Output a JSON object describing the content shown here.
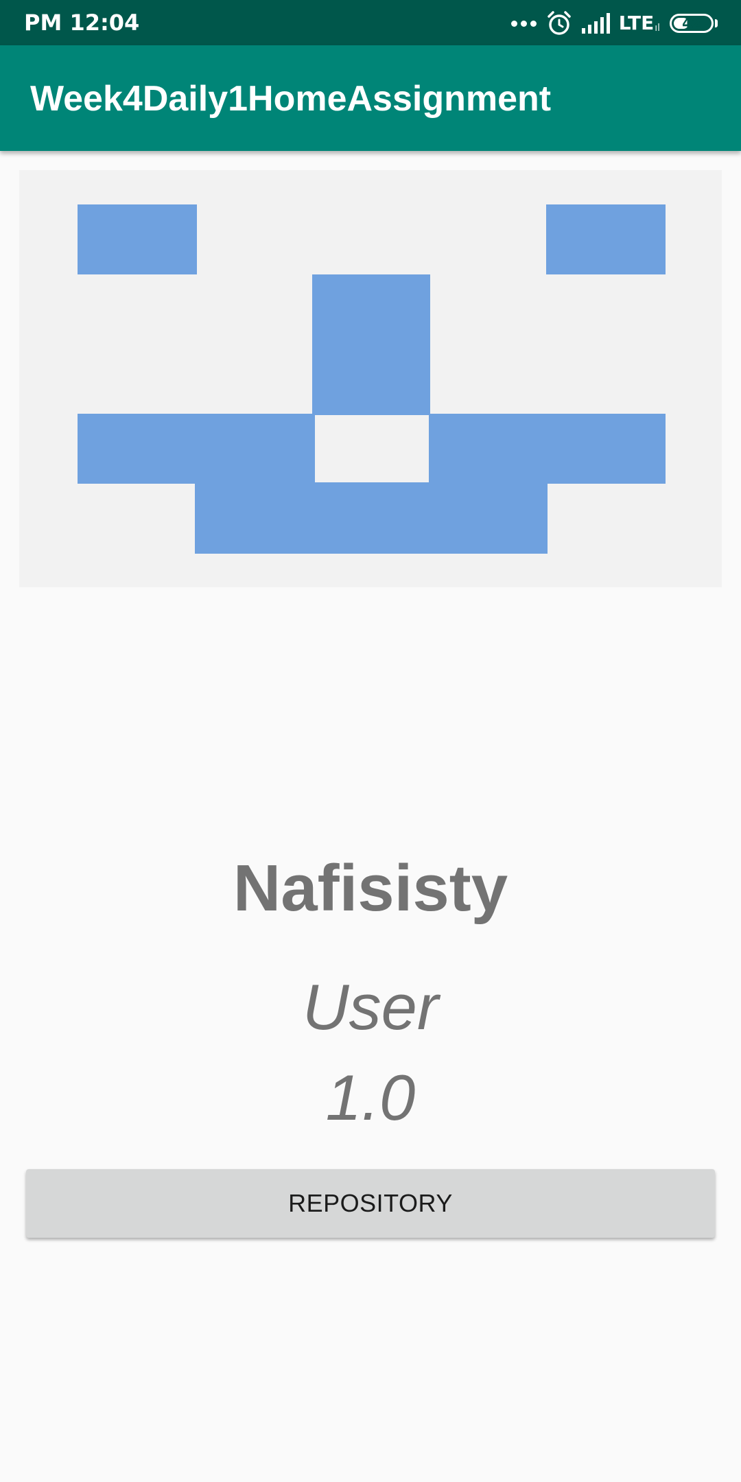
{
  "status_bar": {
    "time": "PM 12:04",
    "network": "LTE",
    "network_sub": "ıl",
    "battery_level": "42",
    "battery_fraction": 0.42,
    "icons": [
      "more-dots-icon",
      "alarm-icon",
      "signal-icon",
      "battery-icon"
    ]
  },
  "app_bar": {
    "title": "Week4Daily1HomeAssignment",
    "color": "#008577"
  },
  "profile": {
    "avatar": {
      "type": "identicon",
      "color": "#6fa1df",
      "background": "#f2f2f2"
    },
    "username": "Nafisisty",
    "user_type": "User",
    "score": "1.0"
  },
  "actions": {
    "repository_label": "REPOSITORY"
  },
  "colors": {
    "status_bar": "#00574b",
    "app_bar": "#008577",
    "background": "#fafafa",
    "text": "#737373",
    "button": "#d6d7d7"
  }
}
